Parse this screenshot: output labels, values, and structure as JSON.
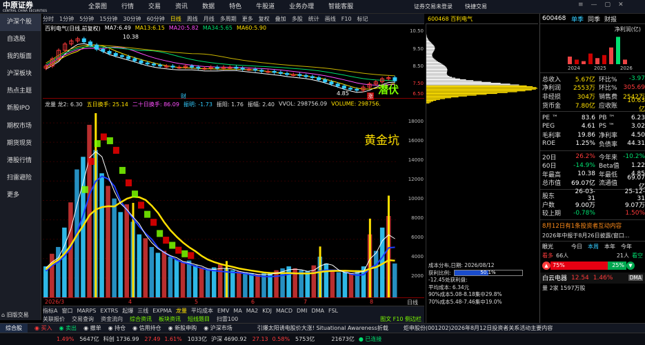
{
  "top": {
    "logo_text": "中原证券",
    "logo_sub": "CENTRAL CHINA SECURITIES",
    "menu": [
      "全景图",
      "行情",
      "交易",
      "资讯",
      "数据",
      "特色",
      "牛股道",
      "业务办理",
      "智能客服"
    ],
    "trade_status": "证券交易未登录",
    "fast_trade": "快捷交易"
  },
  "leftnav": {
    "items": [
      "沪深个股",
      "自选股",
      "我的版面",
      "沪深板块",
      "热点主题",
      "新股IPO",
      "期权市场",
      "期货现货",
      "港股行情",
      "扫雷避险",
      "更多"
    ],
    "old_version": "旧版交易"
  },
  "chart_toolbar": {
    "items": [
      "分时",
      "1分钟",
      "5分钟",
      "15分钟",
      "30分钟",
      "60分钟",
      "日线",
      "周线",
      "月线",
      "多周期",
      "更多",
      "复权",
      "叠加",
      "多股",
      "统计",
      "画线",
      "F10",
      "标记"
    ],
    "active": "日线"
  },
  "price_panel": {
    "title": "百利电气(日线,前复权)",
    "ma": [
      {
        "label": "MA7:",
        "value": "6.49",
        "color": "#ffffff"
      },
      {
        "label": "MA13:",
        "value": "6.15",
        "color": "#ffe000"
      },
      {
        "label": "MA20:",
        "value": "5.82",
        "color": "#ff4fff"
      },
      {
        "label": "MA34:",
        "value": "5.65",
        "color": "#00e070"
      },
      {
        "label": "MA60:",
        "value": "5.90",
        "color": "#ffe000"
      }
    ],
    "axis": [
      "10.50",
      "9.50",
      "8.50",
      "7.50",
      "6.50"
    ],
    "high_label": "10.38",
    "low_label": "4.85",
    "marker_cai": "财",
    "marker_zhang": "涨",
    "annotation": "潜伏",
    "chart_data": {
      "type": "candlestick",
      "title": "百利电气(日线,前复权)",
      "ylim": [
        4.5,
        10.8
      ],
      "high": 10.38,
      "low": 4.85,
      "close": [
        7.6,
        8.3,
        9.1,
        9.7,
        10.0,
        10.2,
        9.9,
        9.6,
        9.2,
        9.0,
        8.8,
        8.6,
        8.5,
        8.3,
        8.1,
        7.9,
        7.8,
        7.7,
        7.6,
        7.6,
        7.5,
        7.5,
        7.6,
        7.5,
        7.4,
        7.4,
        7.5,
        7.4,
        7.5,
        7.5,
        7.4,
        7.3,
        7.3,
        7.2,
        7.1,
        7.1,
        7.0,
        6.9,
        6.8,
        6.8,
        6.7,
        6.6,
        6.5,
        6.3,
        6.1,
        5.9,
        5.7,
        5.5,
        5.4,
        5.3,
        5.6,
        5.9,
        6.1,
        6.4,
        6.5,
        6.2
      ]
    }
  },
  "volume_panel": {
    "legend": [
      {
        "text": "龙量 龙2: 6.30",
        "color": "#dddddd"
      },
      {
        "text": "五日换手: 25.14",
        "color": "#ffe000"
      },
      {
        "text": "二十日换手: 86.09",
        "color": "#ff4fff"
      },
      {
        "text": "振明: -1.73",
        "color": "#3cf"
      },
      {
        "text": "振阳: 1.76",
        "color": "#dddddd"
      },
      {
        "text": "振幅: 2.40",
        "color": "#dddddd"
      },
      {
        "text": "VVOL: 298756.09",
        "color": "#dddddd"
      },
      {
        "text": "VOLUME: 298756.",
        "color": "#ffe000"
      }
    ],
    "axis": [
      "18000",
      "16000",
      "14000",
      "12000",
      "10000",
      "8000",
      "6000",
      "4000",
      "2000"
    ],
    "annotation": "黄金坑",
    "chart_data": {
      "type": "bar",
      "ylim": [
        0,
        19500
      ],
      "values": [
        3200,
        4500,
        5200,
        7200,
        9800,
        13200,
        14500,
        17800,
        15200,
        12800,
        11500,
        10200,
        8800,
        9600,
        7800,
        6500,
        6100,
        5200,
        4600,
        4800,
        4200,
        3900,
        3600,
        3800,
        3300,
        3100,
        2900,
        3100,
        3400,
        3000,
        2800,
        2700,
        2600,
        2500,
        2400,
        2500,
        2600,
        2800,
        3000,
        3200,
        3000,
        2800,
        2700,
        3300,
        4200,
        3500,
        2800,
        2600,
        2700,
        2500,
        2800,
        3200,
        6500,
        4800,
        7200,
        8400,
        3500
      ]
    }
  },
  "x_axis": {
    "labels": [
      "2026/3",
      "4",
      "5",
      "6",
      "7",
      "8"
    ],
    "right": "日线"
  },
  "indicator_tabs": {
    "items": [
      "指标A",
      "窗口",
      "MARPS",
      "EXTRS",
      "起爆",
      "三线",
      "EXPMA",
      "龙量",
      "平均成本",
      "EMV",
      "MA",
      "MA2",
      "KDJ",
      "MACD",
      "DMI",
      "DMA",
      "FSL"
    ],
    "active": "龙量"
  },
  "sub_tabs": {
    "items": [
      "关联报价",
      "交易查询",
      "资金流向",
      "综合资讯",
      "板块资讯",
      "短线题目",
      "扫雷100"
    ],
    "active": "综合资讯",
    "right": "图文 F10 侧边栏"
  },
  "stock_header": "600468 百利电气",
  "cost_distribution": {
    "date": "成本分布,日期: 2026/08/12",
    "profit_ratio_label": "获利比例:",
    "profit_ratio": "50.1%",
    "pnl_line": "-12.45处获利盘:",
    "avg_cost": "平均成本: 6.34元",
    "c90": "90%成本5.08-8.18集中29.8%",
    "c70": "70%成本5.48-7.46集中19.0%"
  },
  "right_panel": {
    "code": "600468",
    "tabs": [
      "单季",
      "同季",
      "财报"
    ],
    "active_tab": "单季",
    "metric": "净利润(亿)",
    "years": [
      "2024",
      "2025",
      "2026"
    ],
    "fundamentals": [
      {
        "k": "总收入",
        "v": "5.67亿",
        "k2": "环比%",
        "v2": "-3.97"
      },
      {
        "k": "净利润",
        "v": "2553万",
        "k2": "环比%",
        "v2": "305.69"
      },
      {
        "k": "非经损",
        "v": "304万",
        "k2": "销售费",
        "v2": "2542万"
      },
      {
        "k": "货币金",
        "v": "7.80亿",
        "k2": "应收账",
        "v2": "10.63亿"
      }
    ],
    "valuation": [
      {
        "k": "PE ™",
        "v": "83.6",
        "k2": "PB ™",
        "v2": "6.23"
      },
      {
        "k": "PEG",
        "v": "4.61",
        "k2": "PS ™",
        "v2": "3.02"
      },
      {
        "k": "毛利率",
        "v": "19.86",
        "k2": "净利率",
        "v2": "4.50"
      },
      {
        "k": "ROE",
        "v": "1.25%",
        "k2": "负债率",
        "v2": "44.31"
      }
    ],
    "performance": [
      {
        "k": "20日",
        "v": "26.2%",
        "k2": "今年来",
        "v2": "-10.2%"
      },
      {
        "k": "60日",
        "v": "-14.9%",
        "k2": "Beta值",
        "v2": "1.22"
      },
      {
        "k": "年最高",
        "v": "10.38",
        "k2": "年最低",
        "v2": "4.85"
      },
      {
        "k": "总市值",
        "v": "69.07亿",
        "k2": "流通值",
        "v2": "69.07亿"
      }
    ],
    "equity": [
      {
        "k": "股东",
        "v": "26-03-31",
        "k2": "",
        "v2": "25-12-31"
      },
      {
        "k": "户数",
        "v": "9.00万",
        "k2": "",
        "v2": "9.07万"
      },
      {
        "k": "较上期",
        "v": "-0.78%",
        "k2": "",
        "v2": "1.50%"
      }
    ],
    "news_title": "8月12日有1条投资者互动内容",
    "news_item": "2026年中报于8月26日披露(窗口...",
    "sentiment_tabs": [
      "眼光",
      "今日",
      "本周",
      "本年",
      "今年"
    ],
    "bull": "看多",
    "bull_count": "66人",
    "bear": "看空",
    "bear_count": "21人",
    "bull_pct": "75%",
    "bear_pct": "25%",
    "related_name": "白云电器",
    "related_price": "12.54",
    "related_chg": "1.46%",
    "related_tag": "DMA",
    "bottom_row": "量 2家 1597万股"
  },
  "bottom_nav": [
    "综合股",
    "买入",
    "卖出",
    "撤单",
    "持仓",
    "信用持仓",
    "新股申购",
    "沪深市场"
  ],
  "ticker": {
    "items": [
      "1.49%",
      "5647亿",
      "科创 1736.99",
      "27.49",
      "1.61%",
      "1033亿",
      "沪深 4690.92",
      "27.13",
      "0.58%",
      "5753亿",
      "21673亿",
      "已连接"
    ],
    "news1": "引爆太阳诱电股价大涨! Situational Awareness折载",
    "news2": "炬申股份(001202)2026年8月12日投资者关系活动主要内容"
  },
  "colors": {
    "up": "#ff3b3b",
    "down": "#00e070",
    "accent": "#ffe000",
    "bg": "#000000",
    "panel": "#131722",
    "cyan": "#33ccff"
  }
}
